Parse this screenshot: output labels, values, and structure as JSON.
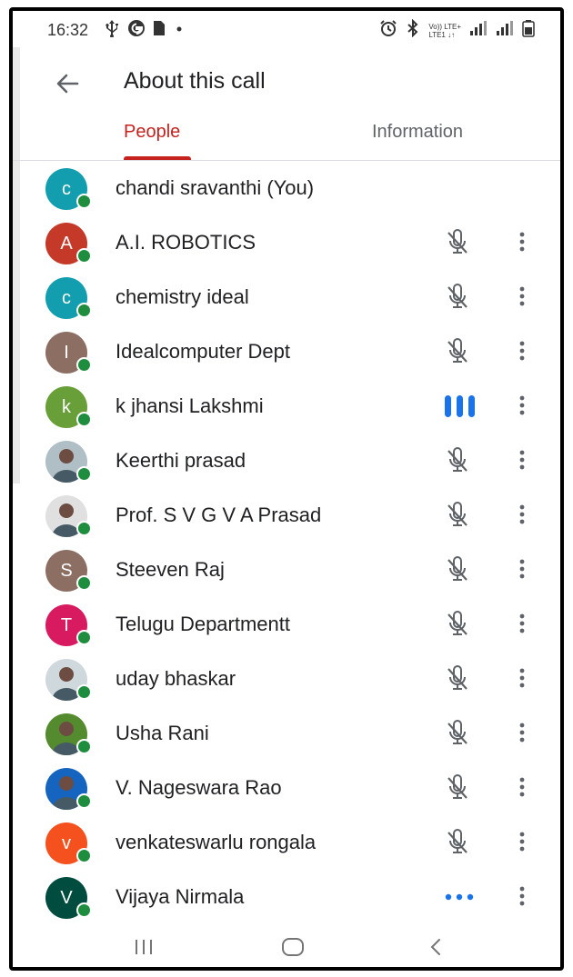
{
  "status_bar": {
    "time": "16:32",
    "left_icons": [
      "usb-icon",
      "google-icon",
      "sim-icon",
      "dot-icon"
    ],
    "right_icons": [
      "alarm-icon",
      "bluetooth-icon",
      "volte-icon",
      "signal-icon",
      "signal-icon",
      "battery-icon"
    ],
    "volte_top": "Vo)) LTE+",
    "volte_bottom": "LTE1 ↓↑"
  },
  "app_bar": {
    "title": "About this call",
    "back_icon": "arrow-back-icon"
  },
  "tabs": [
    {
      "label": "People",
      "selected": true,
      "color": "#c5221f"
    },
    {
      "label": "Information",
      "selected": false,
      "color": "#5f6368"
    }
  ],
  "participants": [
    {
      "name": "chandi sravanthi (You)",
      "initial": "c",
      "avatar_color": "#129eaf",
      "photo": false,
      "mic": "none"
    },
    {
      "name": "A.I. ROBOTICS",
      "initial": "A",
      "avatar_color": "#c53929",
      "photo": false,
      "mic": "muted"
    },
    {
      "name": "chemistry ideal",
      "initial": "c",
      "avatar_color": "#129eaf",
      "photo": false,
      "mic": "muted"
    },
    {
      "name": "Idealcomputer Dept",
      "initial": "I",
      "avatar_color": "#8d6e63",
      "photo": false,
      "mic": "muted"
    },
    {
      "name": "k jhansi Lakshmi",
      "initial": "k",
      "avatar_color": "#689f38",
      "photo": false,
      "mic": "speaking"
    },
    {
      "name": "Keerthi prasad",
      "initial": "",
      "avatar_color": "#b0bec5",
      "photo": true,
      "mic": "muted"
    },
    {
      "name": "Prof. S V G V A Prasad",
      "initial": "",
      "avatar_color": "#e0e0e0",
      "photo": true,
      "mic": "muted"
    },
    {
      "name": "Steeven Raj",
      "initial": "S",
      "avatar_color": "#8d6e63",
      "photo": false,
      "mic": "muted"
    },
    {
      "name": "Telugu Departmentt",
      "initial": "T",
      "avatar_color": "#d81b60",
      "photo": false,
      "mic": "muted"
    },
    {
      "name": "uday bhaskar",
      "initial": "",
      "avatar_color": "#cfd8dc",
      "photo": true,
      "mic": "muted"
    },
    {
      "name": "Usha Rani",
      "initial": "",
      "avatar_color": "#558b2f",
      "photo": true,
      "mic": "muted"
    },
    {
      "name": "V. Nageswara Rao",
      "initial": "",
      "avatar_color": "#1565c0",
      "photo": true,
      "mic": "muted"
    },
    {
      "name": "venkateswarlu rongala",
      "initial": "v",
      "avatar_color": "#f4511e",
      "photo": false,
      "mic": "muted"
    },
    {
      "name": "Vijaya Nirmala",
      "initial": "V",
      "avatar_color": "#004d40",
      "photo": false,
      "mic": "loading"
    }
  ],
  "colors": {
    "accent": "#c5221f",
    "speaking": "#1a73e8",
    "online": "#1e8e3e",
    "icon_gray": "#5f6368"
  },
  "nav_bar": [
    "recent-apps-icon",
    "home-icon",
    "back-icon"
  ]
}
